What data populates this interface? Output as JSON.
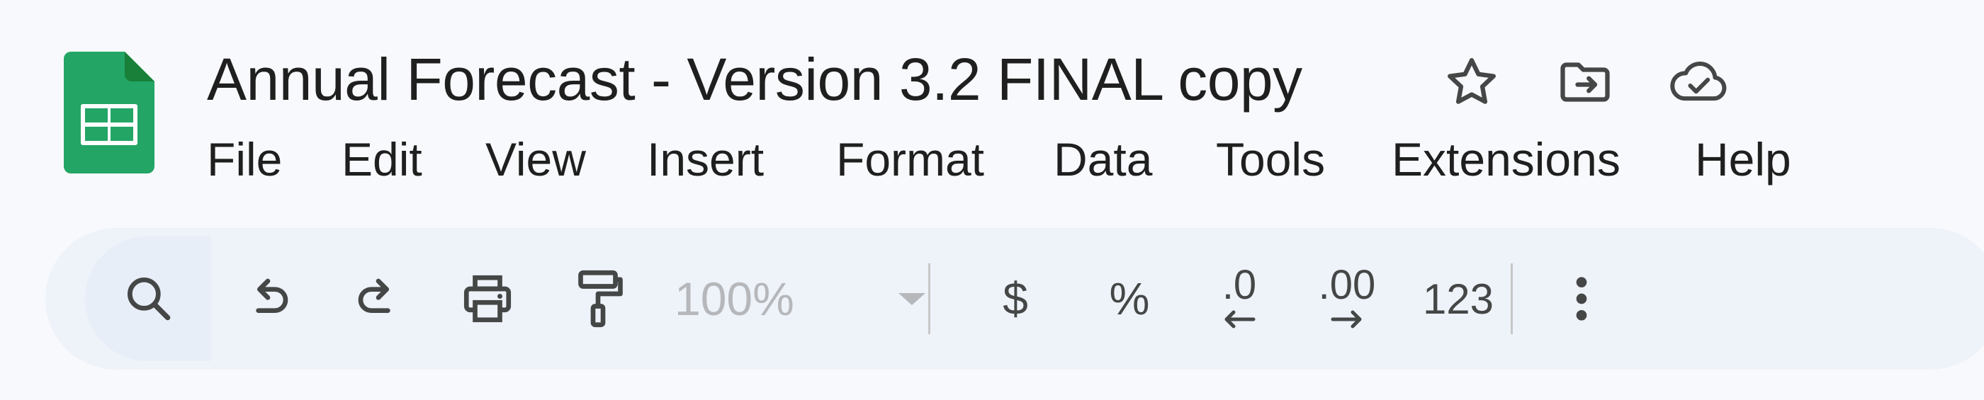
{
  "app": {
    "name": "Google Sheets",
    "logo_icon": "sheets-logo-icon",
    "brand_color": "#23a566"
  },
  "document": {
    "title": "Annual Forecast - Version 3.2 FINAL copy"
  },
  "title_actions": [
    {
      "name": "star-icon",
      "label": "Star"
    },
    {
      "name": "move-folder-icon",
      "label": "Move"
    },
    {
      "name": "cloud-saved-icon",
      "label": "Document status: saved to Drive"
    }
  ],
  "menu": {
    "items": [
      "File",
      "Edit",
      "View",
      "Insert",
      "Format",
      "Data",
      "Tools",
      "Extensions",
      "Help"
    ]
  },
  "toolbar": {
    "search_icon": "search-icon",
    "undo_icon": "undo-icon",
    "redo_icon": "redo-icon",
    "print_icon": "print-icon",
    "paint_format_icon": "paint-format-icon",
    "zoom_value": "100%",
    "zoom_disabled": true,
    "currency_label": "$",
    "percent_label": "%",
    "decrease_decimal_label": ".0",
    "increase_decimal_label": ".00",
    "number_format_label": "123",
    "more_icon": "more-vert-icon"
  },
  "colors": {
    "background": "#f8f9fc",
    "toolbar_background": "#eef2f9",
    "icon": "#444746",
    "disabled": "#b5b7ba"
  }
}
